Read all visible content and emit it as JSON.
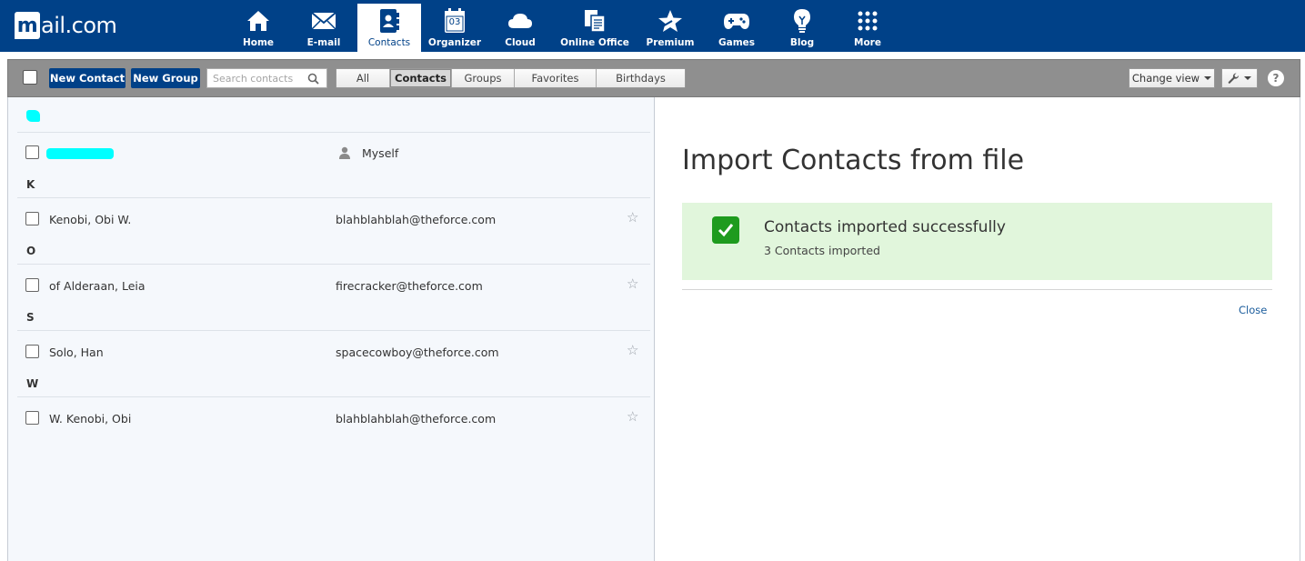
{
  "brand": {
    "logo_text": "mail.com"
  },
  "nav": {
    "items": [
      {
        "label": "Home",
        "icon": "home-icon"
      },
      {
        "label": "E-mail",
        "icon": "mail-icon"
      },
      {
        "label": "Contacts",
        "icon": "contacts-icon",
        "active": true
      },
      {
        "label": "Organizer",
        "icon": "calendar-icon",
        "calendar_day": "03"
      },
      {
        "label": "Cloud",
        "icon": "cloud-icon"
      },
      {
        "label": "Online Office",
        "icon": "office-icon"
      },
      {
        "label": "Premium",
        "icon": "star-icon"
      },
      {
        "label": "Games",
        "icon": "gamepad-icon"
      },
      {
        "label": "Blog",
        "icon": "lightbulb-icon"
      },
      {
        "label": "More",
        "icon": "grid-icon"
      }
    ]
  },
  "toolbar": {
    "new_contact": "New Contact",
    "new_group": "New Group",
    "search_placeholder": "Search contacts",
    "filters": [
      "All",
      "Contacts",
      "Groups",
      "Favorites",
      "Birthdays"
    ],
    "active_filter": "Contacts",
    "change_view": "Change view",
    "help": "?"
  },
  "contacts": {
    "self_label": "Myself",
    "groups": [
      {
        "letter": "K",
        "name": "Kenobi, Obi W.",
        "email": "blahblahblah@theforce.com"
      },
      {
        "letter": "O",
        "name": "of Alderaan, Leia",
        "email": "firecracker@theforce.com"
      },
      {
        "letter": "S",
        "name": "Solo, Han",
        "email": "spacecowboy@theforce.com"
      },
      {
        "letter": "W",
        "name": "W. Kenobi, Obi",
        "email": "blahblahblah@theforce.com"
      }
    ]
  },
  "import": {
    "title": "Import Contacts from file",
    "success_title": "Contacts imported successfully",
    "success_sub": "3 Contacts imported",
    "close": "Close"
  },
  "colors": {
    "brand_blue": "#004188",
    "success_bg": "#e1f6dc",
    "success_check": "#1e9b1e",
    "redaction": "#00ffff"
  }
}
